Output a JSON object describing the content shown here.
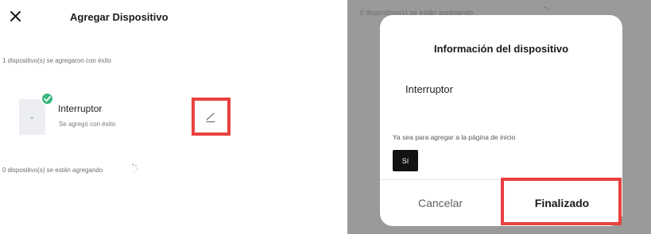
{
  "left": {
    "header": {
      "title": "Agregar Dispositivo"
    },
    "success_message": "1 dispositivo(s) se agregaron con éxito",
    "device": {
      "name": "Interruptor",
      "status": "Se agregó con éxito"
    },
    "adding_message": "0 dispositivo(s) se están agregando"
  },
  "right": {
    "background_message": "0 dispositivo(s) se están agregando",
    "dialog": {
      "title": "Información del dispositivo",
      "device_name": "Interruptor",
      "question": "Ya sea para agregar a la página de inicio",
      "yes_label": "Sí",
      "cancel_label": "Cancelar",
      "finish_label": "Finalizado"
    }
  },
  "colors": {
    "highlight": "#e8413f",
    "success": "#38b87c",
    "overlay": "#9a9a9a",
    "chip": "#121212"
  },
  "icons": [
    "close-icon",
    "check-icon",
    "edit-pencil-icon",
    "loading-spinner-icon"
  ]
}
